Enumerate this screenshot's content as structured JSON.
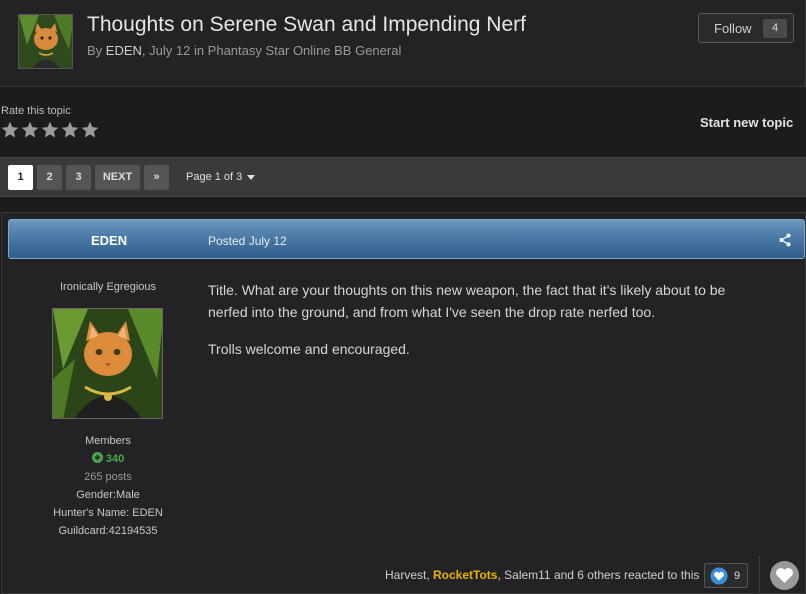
{
  "topic": {
    "title": "Thoughts on Serene Swan and Impending Nerf",
    "meta_prefix": "By",
    "author": "EDEN",
    "meta_suffix": ", July 12 in Phantasy Star Online BB General"
  },
  "follow": {
    "label": "Follow",
    "count": "4"
  },
  "rating": {
    "label": "Rate this topic",
    "stars": 5,
    "value": 0
  },
  "start_topic": "Start new topic",
  "pagination": {
    "pages": [
      "1",
      "2",
      "3"
    ],
    "current": "1",
    "next": "NEXT",
    "last": "»",
    "page_of": "Page 1 of 3"
  },
  "post": {
    "author": "EDEN",
    "date": "Posted July 12",
    "user_title": "Ironically Egregious",
    "group": "Members",
    "reputation": "340",
    "posts": "265 posts",
    "gender": "Gender:Male",
    "hunter_name": "Hunter's Name: EDEN",
    "guildcard": "Guildcard:42194535",
    "body": [
      "Title. What are your thoughts on this new weapon, the fact that it's likely about to be nerfed into the ground, and from what I've seen the drop rate nerfed too.",
      "Trolls welcome and encouraged."
    ],
    "reactions": {
      "names_a": "Harvest, ",
      "highlight": "RocketTots",
      "names_b": ", Salem11 and 6 others reacted to this",
      "count": "9"
    }
  },
  "icons": {
    "star": "star-icon",
    "share": "share-icon",
    "plus": "plus-circle-icon",
    "like": "heart-icon"
  },
  "colors": {
    "post_bar": "#4a7aa6",
    "reputation": "#4aa84a",
    "highlight_user": "#e8b400"
  }
}
